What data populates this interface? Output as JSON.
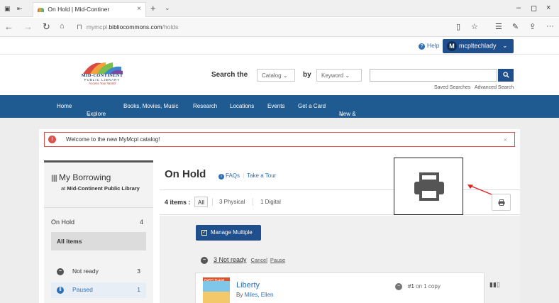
{
  "browser": {
    "tab_title": "On Hold | Mid-Continer",
    "url_prefix": "mymcpl.",
    "url_domain": "bibliocommons.com",
    "url_path": "/holds"
  },
  "topnav": {
    "help_label": "Help",
    "user_initial": "M",
    "user_name": "mcpltechlady"
  },
  "header": {
    "logo_name": "MID-CONTINENT",
    "logo_sub": "PUBLIC LIBRARY",
    "logo_tagline": "Access Your World",
    "search_the": "Search the",
    "catalog_select": "Catalog",
    "by_label": "by",
    "keyword_select": "Keyword",
    "saved_searches": "Saved Searches",
    "advanced_search": "Advanced Search"
  },
  "mainnav": {
    "items": [
      "Home",
      "Explore",
      "Books, Movies, Music",
      "Research",
      "Locations",
      "Events",
      "Get a Card",
      "New & Forthcoming"
    ]
  },
  "banner": {
    "message": "Welcome to the new MyMcpl catalog!"
  },
  "sidebar": {
    "title": "My Borrowing",
    "at_label": "at",
    "library": "Mid-Continent Public Library",
    "on_hold_label": "On Hold",
    "on_hold_count": "4",
    "all_items": "All items",
    "statuses": [
      {
        "label": "Not ready",
        "count": "3",
        "color": "#555555"
      },
      {
        "label": "Paused",
        "count": "1",
        "color": "#2f6fb3"
      }
    ]
  },
  "main": {
    "title": "On Hold",
    "faqs": "FAQs",
    "take_tour": "Take a Tour",
    "items_count_label": "4 items :",
    "filters": [
      "All",
      "3 Physical",
      "1 Digital"
    ],
    "manage_multiple": "Manage Multiple",
    "group_label": "3 Not ready",
    "group_cancel": "Cancel",
    "group_pause": "Pause",
    "hold": {
      "cover_text": "PUPPY PLACE",
      "title": "Liberty",
      "by": "By",
      "author": "Miles, Ellen",
      "queue_position": "#1",
      "queue_text": "on 1 copy"
    }
  },
  "colors": {
    "brand_blue": "#1f5a91",
    "button_blue": "#1f4f8c",
    "link_blue": "#2f6fb3",
    "alert_red": "#d9534f"
  }
}
